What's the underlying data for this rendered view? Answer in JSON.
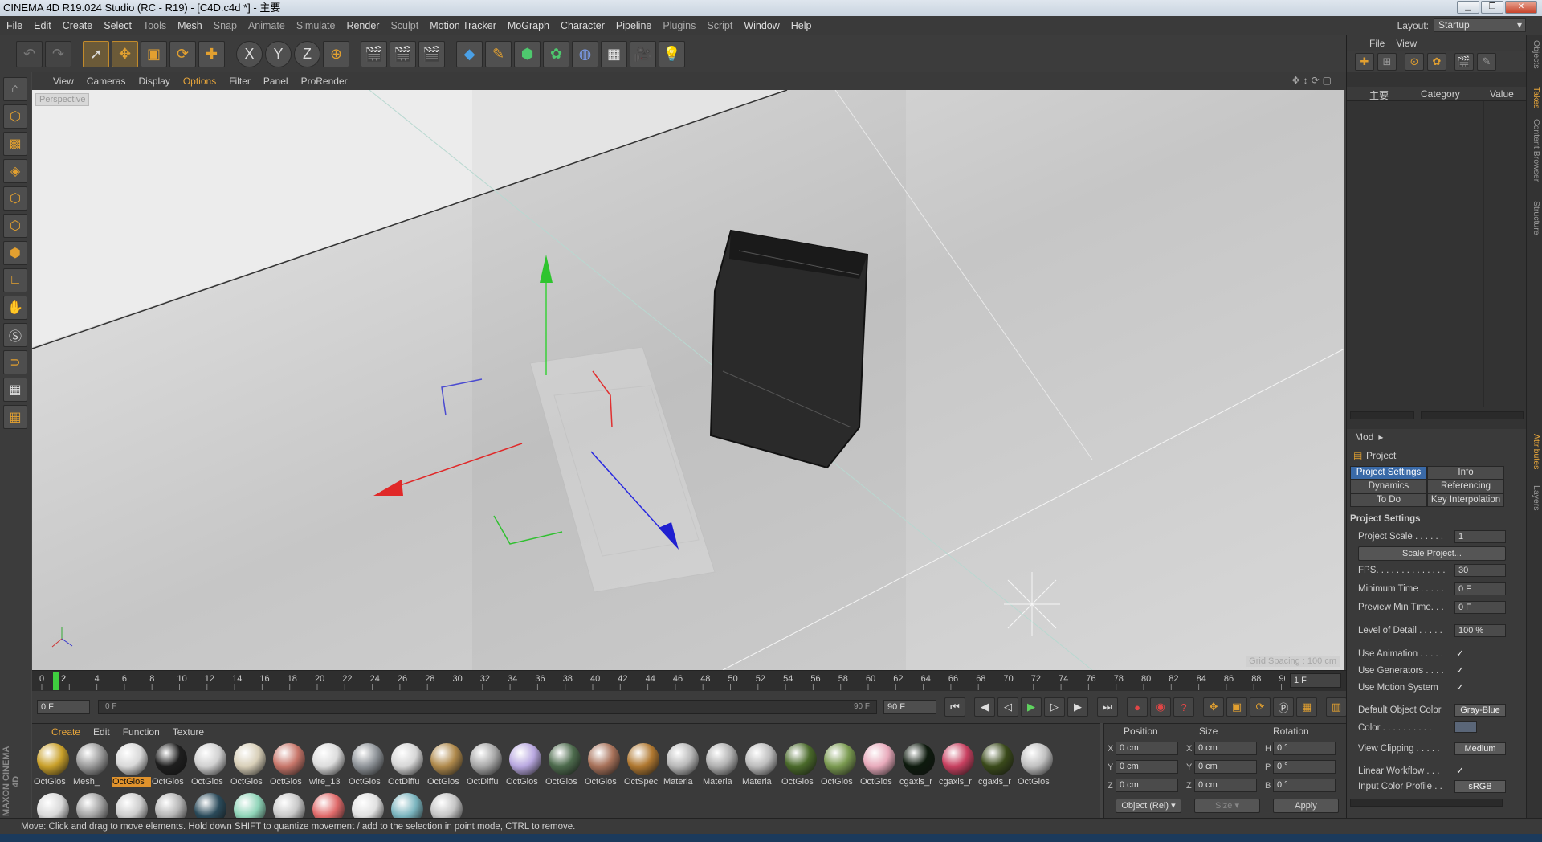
{
  "window": {
    "title": "CINEMA 4D R19.024 Studio (RC - R19) - [C4D.c4d *] - 主要"
  },
  "menu": [
    "File",
    "Edit",
    "Create",
    "Select",
    "Tools",
    "Mesh",
    "Snap",
    "Animate",
    "Simulate",
    "Render",
    "Sculpt",
    "Motion Tracker",
    "MoGraph",
    "Character",
    "Pipeline",
    "Plugins",
    "Script",
    "Window",
    "Help"
  ],
  "layout": {
    "label": "Layout:",
    "value": "Startup"
  },
  "viewport": {
    "menu": [
      "View",
      "Cameras",
      "Display",
      "Options",
      "Filter",
      "Panel",
      "ProRender"
    ],
    "selected_menu": "Options",
    "label": "Perspective",
    "grid_spacing": "Grid Spacing : 100 cm"
  },
  "timeline": {
    "ticks": [
      "0",
      "2",
      "4",
      "6",
      "8",
      "10",
      "12",
      "14",
      "16",
      "18",
      "20",
      "22",
      "24",
      "26",
      "28",
      "30",
      "32",
      "34",
      "36",
      "38",
      "40",
      "42",
      "44",
      "46",
      "48",
      "50",
      "52",
      "54",
      "56",
      "58",
      "60",
      "62",
      "64",
      "66",
      "68",
      "70",
      "72",
      "74",
      "76",
      "78",
      "80",
      "82",
      "84",
      "86",
      "88",
      "90"
    ],
    "current_marker": "1 2",
    "frame_display": "1 F",
    "start": "0 F",
    "slider_left": "0 F",
    "slider_right": "90 F",
    "end": "90 F"
  },
  "materials": {
    "menu": [
      "Create",
      "Edit",
      "Function",
      "Texture"
    ],
    "row1": [
      {
        "label": "OctGlos",
        "color": "#c9a02a"
      },
      {
        "label": "Mesh_",
        "color": "#9a9a9a"
      },
      {
        "label": "OctGlos",
        "color": "#d8d8d8",
        "selected": true
      },
      {
        "label": "OctGlos",
        "color": "#1e1e1e"
      },
      {
        "label": "OctGlos",
        "color": "#d0d0d0"
      },
      {
        "label": "OctGlos",
        "color": "#d8cfb8"
      },
      {
        "label": "OctGlos",
        "color": "#c8766a"
      },
      {
        "label": "wire_13",
        "color": "#dcdcdc"
      },
      {
        "label": "OctGlos",
        "color": "#8f9499"
      },
      {
        "label": "OctDiffu",
        "color": "#d6d6d6"
      },
      {
        "label": "OctGlos",
        "color": "#b08a4c"
      },
      {
        "label": "OctDiffu",
        "color": "#a8a8a8"
      },
      {
        "label": "OctGlos",
        "color": "#b9a8e0"
      },
      {
        "label": "OctGlos",
        "color": "#4d6b4d"
      },
      {
        "label": "OctGlos",
        "color": "#a8725a"
      },
      {
        "label": "OctSpec",
        "color": "#b07830"
      },
      {
        "label": "Materia",
        "color": "#b8b8b8"
      },
      {
        "label": "Materia",
        "color": "#b0b0b0"
      },
      {
        "label": "Materia",
        "color": "#bcbcbc"
      },
      {
        "label": "OctGlos",
        "color": "#4a6a2a"
      },
      {
        "label": "OctGlos",
        "color": "#7a9a50"
      },
      {
        "label": "OctGlos",
        "color": "#e8aabb"
      },
      {
        "label": "cgaxis_r",
        "color": "#0d1a0d"
      },
      {
        "label": "cgaxis_r",
        "color": "#c84060"
      },
      {
        "label": "cgaxis_r",
        "color": "#3a4a1a"
      },
      {
        "label": "OctGlos",
        "color": "#c0c0c0"
      }
    ],
    "row2": [
      {
        "color": "#d8d8d8"
      },
      {
        "color": "#a0a0a0"
      },
      {
        "color": "#cccccc"
      },
      {
        "color": "#b4b4b4"
      },
      {
        "color": "#2a4a5a"
      },
      {
        "color": "#8fd4b8"
      },
      {
        "color": "#c8c8c8"
      },
      {
        "color": "#e06a6a"
      },
      {
        "color": "#e0e0e0"
      },
      {
        "color": "#7ab4be"
      },
      {
        "color": "#c4c4c4"
      }
    ]
  },
  "coords": {
    "headers": [
      "Position",
      "Size",
      "Rotation"
    ],
    "rows": [
      {
        "axis": "X",
        "pos": "0 cm",
        "saxis": "X",
        "size": "0 cm",
        "raxis": "H",
        "rot": "0 °"
      },
      {
        "axis": "Y",
        "pos": "0 cm",
        "saxis": "Y",
        "size": "0 cm",
        "raxis": "P",
        "rot": "0 °"
      },
      {
        "axis": "Z",
        "pos": "0 cm",
        "saxis": "Z",
        "size": "0 cm",
        "raxis": "B",
        "rot": "0 °"
      }
    ],
    "mode": "Object (Rel)",
    "size_mode": "Size",
    "apply": "Apply"
  },
  "objects": {
    "menu": [
      "File",
      "View"
    ],
    "columns": {
      "name": "主要",
      "category": "Category",
      "value": "Value"
    }
  },
  "attributes": {
    "mode": "Mod",
    "title": "Project",
    "tabs": [
      [
        "Project Settings",
        "Info"
      ],
      [
        "Dynamics",
        "Referencing"
      ],
      [
        "To Do",
        "Key Interpolation"
      ]
    ],
    "section": "Project Settings",
    "scale_button": "Scale Project...",
    "props": [
      {
        "label": "Project Scale . . . . . .",
        "value": "1",
        "type": "field"
      },
      {
        "label": "FPS. . . . . . . . . . . . . .",
        "value": "30",
        "type": "field"
      },
      {
        "label": "Minimum Time . . . . .",
        "value": "0 F",
        "type": "field"
      },
      {
        "label": "Preview Min Time. . .",
        "value": "0 F",
        "type": "field"
      },
      {
        "label": "Level of Detail . . . . .",
        "value": "100 %",
        "type": "field"
      },
      {
        "label": "Use Animation . . . . .",
        "value": "✓",
        "type": "check"
      },
      {
        "label": "Use Generators . . . .",
        "value": "✓",
        "type": "check"
      },
      {
        "label": "Use Motion System",
        "value": "✓",
        "type": "check"
      },
      {
        "label": "Default Object Color",
        "value": "Gray-Blue",
        "type": "drop"
      },
      {
        "label": "Color . . . . . . . . . .",
        "value": "",
        "type": "swatch"
      },
      {
        "label": "View Clipping . . . . .",
        "value": "Medium",
        "type": "drop"
      },
      {
        "label": "Linear Workflow . . .",
        "value": "✓",
        "type": "check"
      },
      {
        "label": "Input Color Profile . .",
        "value": "sRGB",
        "type": "drop"
      }
    ]
  },
  "side_tabs": [
    "Objects",
    "Takes",
    "Content Browser",
    "Structure",
    "Attributes",
    "Layers"
  ],
  "status": "Move: Click and drag to move elements. Hold down SHIFT to quantize movement / add to the selection in point mode, CTRL to remove."
}
